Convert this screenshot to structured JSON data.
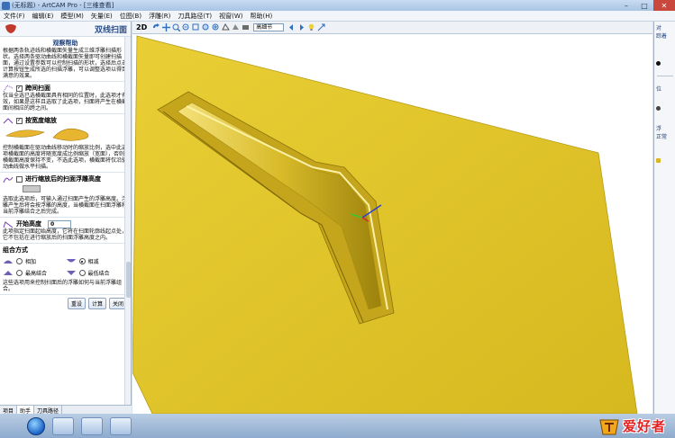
{
  "window": {
    "title": "(无标题) - ArtCAM Pro - [三维查看]",
    "controls": [
      "–",
      "□",
      "✕"
    ]
  },
  "menu": [
    "文件(F)",
    "编辑(E)",
    "模型(M)",
    "矢量(E)",
    "位图(B)",
    "浮雕(R)",
    "刀具路径(T)",
    "视窗(W)",
    "帮助(H)"
  ],
  "left_panel": {
    "title": "双线扫面",
    "help_heading": "观察帮助",
    "help_text": "根据两条轨迹线和横截面矢量生成三维浮雕扫描形状。选择两条驱动曲线和横截面矢量即可创建扫描面，通过设置参数可以控制扫描的形状，选择后点击计算按钮生成所选的扫描浮雕，可以调整选项以得到满意的效果。",
    "span": {
      "label": "跨间扫面",
      "checked": true,
      "text": "仅当全选已选横截面具有相同的位置时，此选项才有效，如果是这样且选取了此选项，扫面将产生在横截面间相应的跨之间。"
    },
    "scale_height": {
      "label": "按宽度缩放",
      "checked": true,
      "text": "控制横截面在驱动曲线移动时的缩放比例，选中此选项横截面的高度将随宽度成比例缩放（宽面），否则横截面高度保持不变，不选此选项，横截面将仅沿驱动曲线做水平扫描。"
    },
    "float_height": {
      "label": "进行缩放后的扫面浮雕高度",
      "checked": false,
      "text": "选取此选项后，可输入通过扫面产生的浮雕高度。浮雕产生后将会按浮雕的高度，当横截面在扫面浮雕和当前浮雕结合之后完成。"
    },
    "start_height": {
      "label": "开始高度",
      "value": "0",
      "text": "此项指定扫面起始高度，它将在扫面轮廓线起点处，它不包括在进行缩放后的扫面浮雕高度之内。"
    },
    "combine": {
      "label": "组合方式",
      "options": [
        {
          "label": "相加",
          "selected": false
        },
        {
          "label": "相减",
          "selected": true
        },
        {
          "label": "最高结合",
          "selected": false
        },
        {
          "label": "最低结合",
          "selected": false
        }
      ],
      "text": "这些选项用来控制扫面后的浮雕如何与当前浮雕组合。"
    },
    "buttons": [
      "重设",
      "计算",
      "关闭"
    ]
  },
  "bottom_tabs": [
    "项目",
    "助手",
    "刀具路径"
  ],
  "toolbar": {
    "mode_label": "2D",
    "quality_select": "高细节"
  },
  "right_panel": {
    "labels": [
      "对",
      "踪着",
      "位",
      "浮",
      "正常"
    ]
  },
  "watermark": {
    "text": "爱好者"
  },
  "colors": {
    "relief_yellow": "#e5c728",
    "relief_shadow": "#b89a10",
    "title_accent": "#2b4f8c"
  }
}
